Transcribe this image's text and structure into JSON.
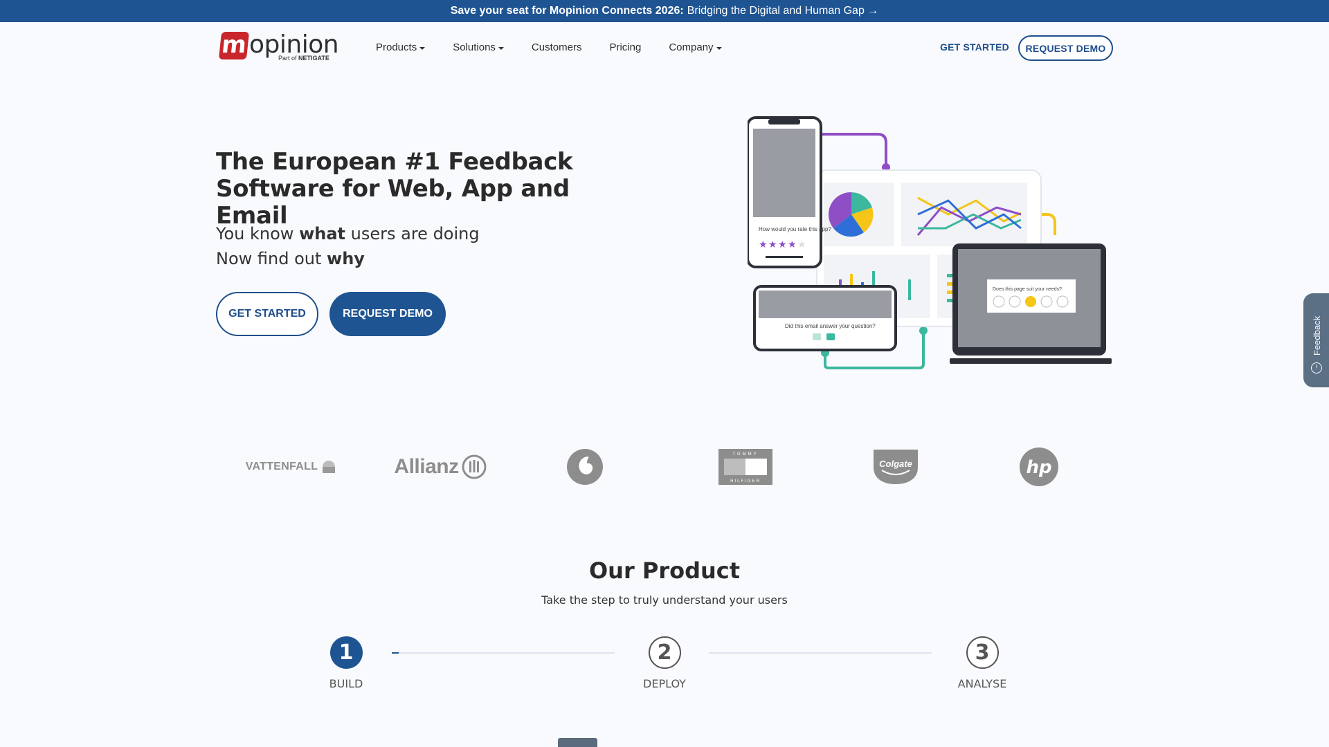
{
  "announcement": {
    "bold": "Save your seat for Mopinion Connects 2026:",
    "text": "Bridging the Digital and Human Gap →"
  },
  "logo": {
    "badge": "m",
    "word": "opinion",
    "sub_prefix": "Part of",
    "sub_brand": "NETIGATE"
  },
  "nav": [
    {
      "label": "Products",
      "dropdown": true
    },
    {
      "label": "Solutions",
      "dropdown": true
    },
    {
      "label": "Customers",
      "dropdown": false
    },
    {
      "label": "Pricing",
      "dropdown": false
    },
    {
      "label": "Company",
      "dropdown": true
    }
  ],
  "header": {
    "get_started": "GET STARTED",
    "request_demo": "REQUEST DEMO"
  },
  "hero": {
    "title": "The European #1 Feedback Software for Web, App and Email",
    "line1_a": "You know",
    "line1_b": "what",
    "line1_c": "users are doing",
    "line2_a": "Now find out",
    "line2_b": "why",
    "btn_get_started": "GET STARTED",
    "btn_request_demo": "REQUEST DEMO"
  },
  "illustration": {
    "phone_question": "How would you rate this app?",
    "email_question": "Did this email answer your question?",
    "laptop_question": "Does this page suit your needs?"
  },
  "feedback_tab": {
    "label": "Feedback"
  },
  "clients": [
    {
      "name": "VATTENFALL"
    },
    {
      "name": "Allianz"
    },
    {
      "name": "vodafone"
    },
    {
      "name": "TOMMY HILFIGER",
      "top": "TOMMY",
      "bottom": "HILFIGER"
    },
    {
      "name": "Colgate"
    },
    {
      "name": "hp"
    }
  ],
  "product": {
    "title": "Our Product",
    "subtitle": "Take the step to truly understand your users",
    "steps": [
      {
        "number": "1",
        "label": "BUILD",
        "active": true
      },
      {
        "number": "2",
        "label": "DEPLOY",
        "active": false
      },
      {
        "number": "3",
        "label": "ANALYSE",
        "active": false
      }
    ]
  },
  "colors": {
    "primary": "#1f5492",
    "brand_red": "#c8262c",
    "background": "#f9fafd",
    "accent_purple": "#8e4ec6",
    "accent_teal": "#3bb89e",
    "accent_yellow": "#f5c518"
  }
}
